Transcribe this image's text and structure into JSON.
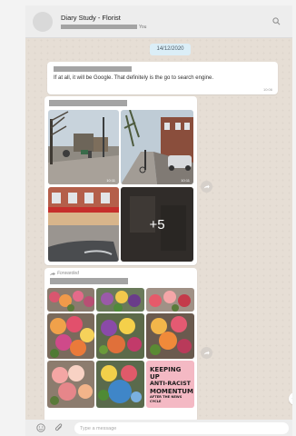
{
  "header": {
    "title": "Diary Study - Florist",
    "subtitle_suffix": "You"
  },
  "chat": {
    "date_chip": "14/12/2020",
    "messages": [
      {
        "text": "If at all, it will be Google. That definitely is the go to search engine.",
        "time": "10:06"
      },
      {
        "image_times": [
          "10:11",
          "10:11"
        ],
        "more_count": "+5"
      },
      {
        "forwarded_label": "Forwarded",
        "poster_text": [
          "KEEPING UP",
          "ANTI-RACIST",
          "MOMENTUM",
          "AFTER THE NEWS CYCLE"
        ]
      }
    ]
  },
  "composer": {
    "placeholder": "Type a message"
  },
  "icons": {
    "search": "search-icon",
    "emoji": "smiley-icon",
    "attach": "paperclip-icon",
    "forward": "forward-arrow-icon",
    "scroll": "scroll-down-icon"
  },
  "colors": {
    "chat_background": "#e6ded5",
    "date_chip": "#dbeef7",
    "header": "#ededed"
  }
}
